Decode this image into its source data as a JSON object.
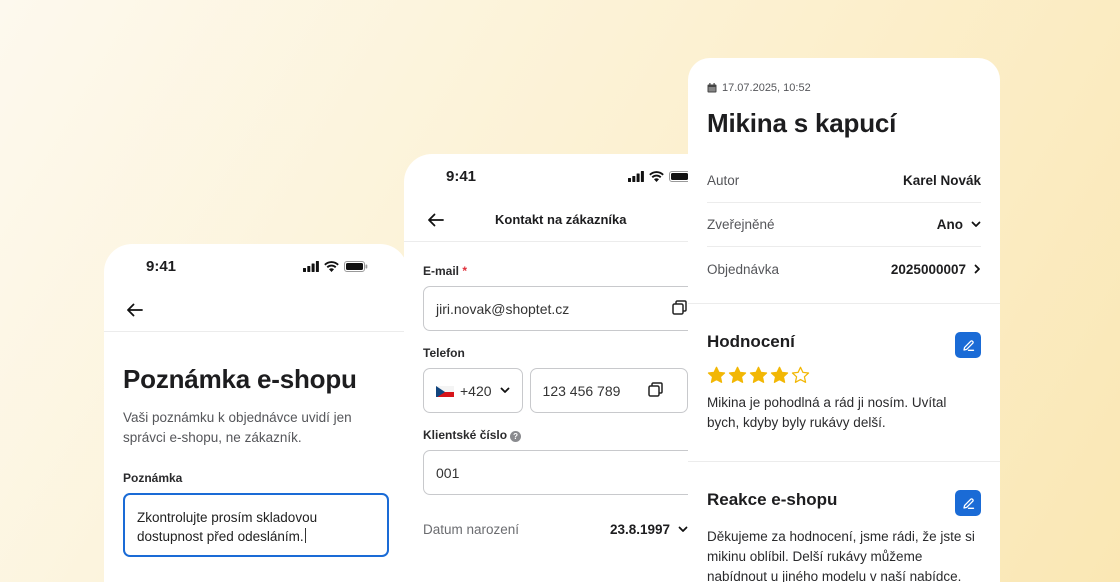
{
  "screen1": {
    "time": "9:41",
    "title": "Poznámka e-shopu",
    "description": "Vaši poznámku k objednávce uvidí jen správci e-shopu, ne zákazník.",
    "note_label": "Poznámka",
    "note_value": "Zkontrolujte prosím skladovou dostupnost před odesláním."
  },
  "screen2": {
    "time": "9:41",
    "nav_title": "Kontakt na zákazníka",
    "email_label": "E-mail",
    "required_mark": "*",
    "email_value": "jiri.novak@shoptet.cz",
    "phone_label": "Telefon",
    "phone_prefix": "+420",
    "phone_value": "123 456 789",
    "client_label": "Klientské číslo",
    "help_glyph": "?",
    "client_value": "001",
    "birth_label": "Datum narození",
    "birth_value": "23.8.1997"
  },
  "screen3": {
    "timestamp": "17.07.2025, 10:52",
    "title": "Mikina s kapucí",
    "rows": [
      {
        "key": "Autor",
        "value": "Karel Novák"
      },
      {
        "key": "Zveřejněné",
        "value": "Ano"
      },
      {
        "key": "Objednávka",
        "value": "2025000007"
      }
    ],
    "rating_title": "Hodnocení",
    "rating": 4,
    "rating_max": 5,
    "review_text": "Mikina je pohodlná a rád ji nosím. Uvítal bych, kdyby byly rukávy delší.",
    "reply_title": "Reakce e-shopu",
    "reply_text": "Děkujeme za hodnocení, jsme rádi, že jste si mikinu oblíbil. Delší rukávy můžeme nabídnout u jiného modelu v naší nabídce."
  },
  "colors": {
    "accent": "#1a6bd6",
    "star": "#f2b705",
    "required": "#e0303b"
  },
  "icons": [
    "back-arrow-icon",
    "signal-icon",
    "wifi-icon",
    "battery-icon",
    "copy-icon",
    "czech-flag-icon",
    "chevron-down-icon",
    "chevron-right-icon",
    "help-icon",
    "calendar-icon",
    "edit-icon",
    "star-icon"
  ]
}
